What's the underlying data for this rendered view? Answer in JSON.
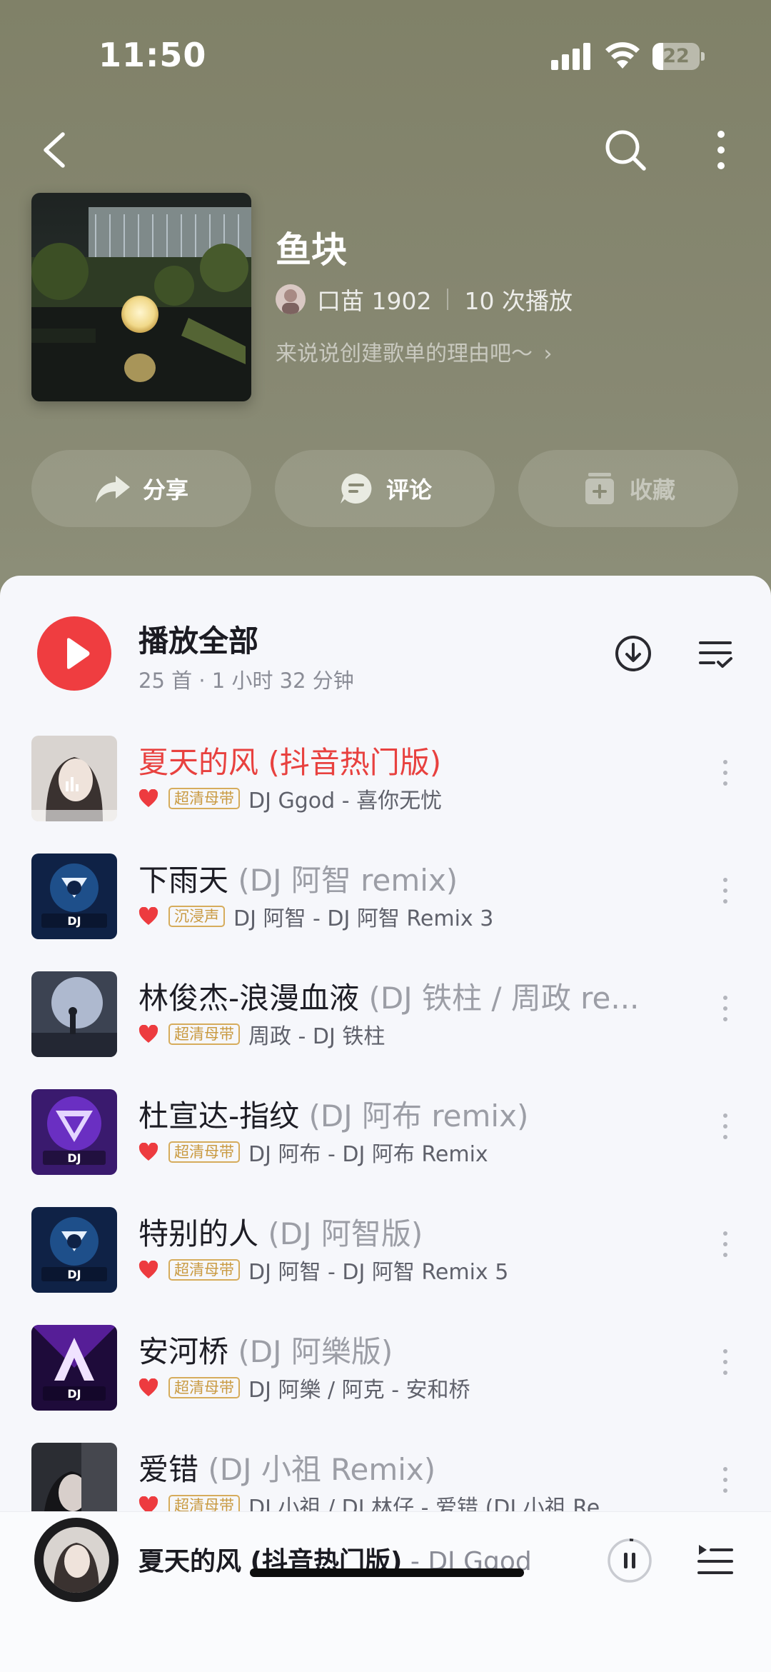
{
  "status_bar": {
    "time": "11:50",
    "battery": "22",
    "battery_level": 0.22
  },
  "playlist": {
    "title": "鱼块",
    "creator": "口苗 1902",
    "play_count": "10 次播放",
    "description": "来说说创建歌单的理由吧～"
  },
  "actions": {
    "share": "分享",
    "comment": "评论",
    "collect": "收藏"
  },
  "play_all": {
    "label": "播放全部",
    "summary": "25 首 · 1 小时 32 分钟"
  },
  "songs": [
    {
      "title": "夏天的风 (抖音热门版)",
      "subtitle": "",
      "badge": "超清母带",
      "artist": "DJ Ggod - 喜你无忧",
      "playing": true
    },
    {
      "title": "下雨天",
      "subtitle": " (DJ 阿智 remix)",
      "badge": "沉浸声",
      "artist": "DJ 阿智 - DJ 阿智 Remix 3"
    },
    {
      "title": "林俊杰-浪漫血液",
      "subtitle": " (DJ 铁柱 / 周政 re...",
      "badge": "超清母带",
      "artist": "周政 - DJ 铁柱"
    },
    {
      "title": "杜宣达-指纹",
      "subtitle": " (DJ 阿布 remix)",
      "badge": "超清母带",
      "artist": "DJ 阿布 - DJ 阿布 Remix"
    },
    {
      "title": "特别的人",
      "subtitle": " (DJ 阿智版)",
      "badge": "超清母带",
      "artist": "DJ 阿智 - DJ 阿智 Remix 5"
    },
    {
      "title": "安河桥",
      "subtitle": " (DJ 阿樂版)",
      "badge": "超清母带",
      "artist": "DJ 阿樂 / 阿克 - 安和桥"
    },
    {
      "title": "爱错",
      "subtitle": " (DJ 小祖 Remix)",
      "badge": "超清母带",
      "artist": "DJ 小祖 / DJ 林仔 - 爱错 (DJ 小祖 Re..."
    }
  ],
  "mini_player": {
    "title": "夏天的风 (抖音热门版)",
    "artist": " - DJ Ggod"
  },
  "colors": {
    "accent": "#ef3d40",
    "header": "#838470",
    "badge": "#d6ac5c"
  },
  "icons": [
    "back-icon",
    "search-icon",
    "more-vertical-icon",
    "share-icon",
    "comment-icon",
    "collect-icon",
    "play-icon",
    "download-icon",
    "playlist-manage-icon",
    "heart-icon",
    "pause-icon",
    "queue-icon"
  ]
}
